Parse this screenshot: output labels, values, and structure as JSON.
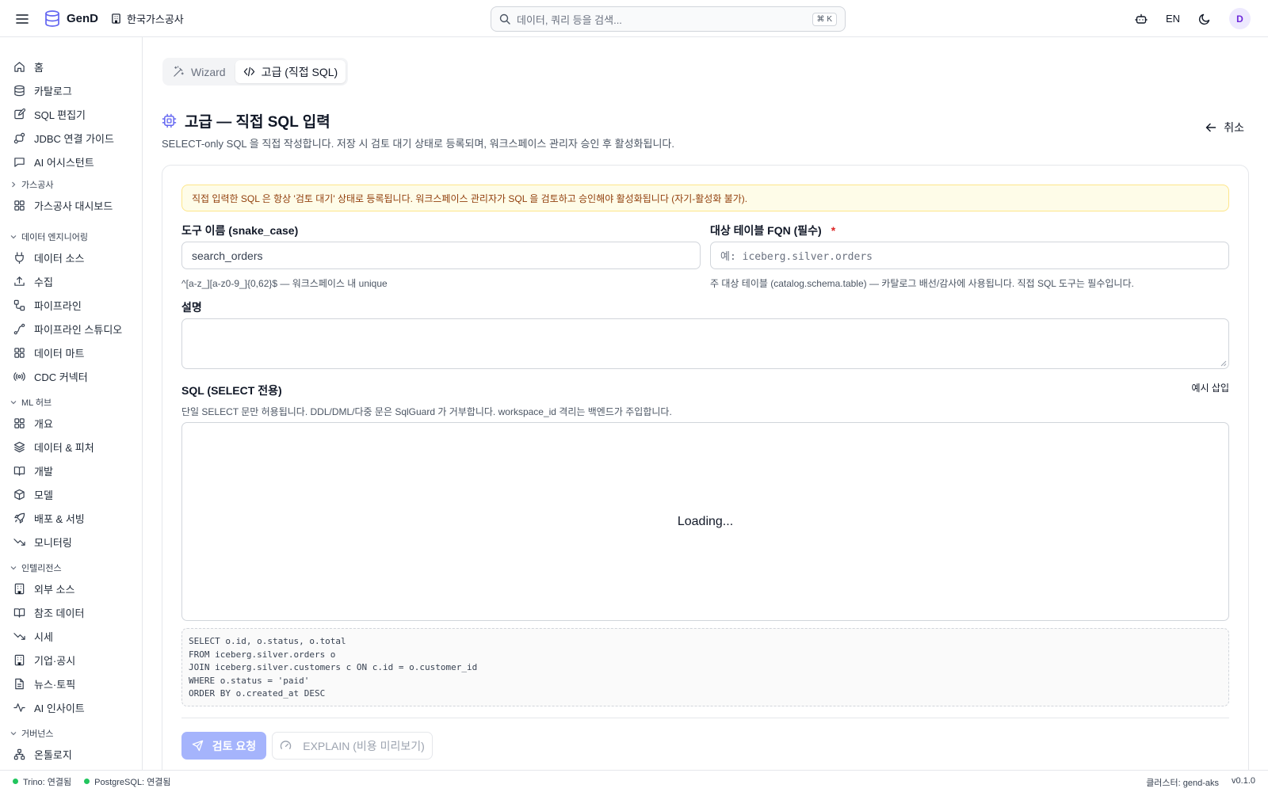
{
  "app": {
    "name": "GenD",
    "org": "한국가스공사"
  },
  "search": {
    "placeholder": "데이터, 쿼리 등을 검색...",
    "shortcut": "⌘ K"
  },
  "top": {
    "lang": "EN",
    "avatar": "D"
  },
  "sidebar": {
    "main": [
      {
        "label": "홈",
        "icon": "home-icon"
      },
      {
        "label": "카탈로그",
        "icon": "database-icon"
      },
      {
        "label": "SQL 편집기",
        "icon": "edit-icon"
      },
      {
        "label": "JDBC 연결 가이드",
        "icon": "plug-icon"
      },
      {
        "label": "AI 어시스턴트",
        "icon": "chat-icon"
      }
    ],
    "groups": [
      {
        "label": "가스공사",
        "collapsed": true,
        "items": [
          {
            "label": "가스공사 대시보드",
            "icon": "grid-icon"
          }
        ]
      },
      {
        "label": "데이터 엔지니어링",
        "collapsed": false,
        "items": [
          {
            "label": "데이터 소스",
            "icon": "plug-icon"
          },
          {
            "label": "수집",
            "icon": "upload-icon"
          },
          {
            "label": "파이프라인",
            "icon": "workflow-icon"
          },
          {
            "label": "파이프라인 스튜디오",
            "icon": "spline-icon"
          },
          {
            "label": "데이터 마트",
            "icon": "grid-icon"
          },
          {
            "label": "CDC 커넥터",
            "icon": "radio-icon"
          }
        ]
      },
      {
        "label": "ML 허브",
        "collapsed": false,
        "items": [
          {
            "label": "개요",
            "icon": "grid-icon"
          },
          {
            "label": "데이터 & 피처",
            "icon": "layers-icon"
          },
          {
            "label": "개발",
            "icon": "book-icon"
          },
          {
            "label": "모델",
            "icon": "box-icon"
          },
          {
            "label": "배포 & 서빙",
            "icon": "rocket-icon"
          },
          {
            "label": "모니터링",
            "icon": "trending-down-icon"
          }
        ]
      },
      {
        "label": "인텔리전스",
        "collapsed": false,
        "items": [
          {
            "label": "외부 소스",
            "icon": "building-icon"
          },
          {
            "label": "참조 데이터",
            "icon": "book-icon"
          },
          {
            "label": "시세",
            "icon": "trending-down-icon"
          },
          {
            "label": "기업·공시",
            "icon": "building-icon"
          },
          {
            "label": "뉴스·토픽",
            "icon": "file-icon"
          },
          {
            "label": "AI 인사이트",
            "icon": "activity-icon"
          }
        ]
      },
      {
        "label": "거버넌스",
        "collapsed": false,
        "items": [
          {
            "label": "온톨로지",
            "icon": "network-icon"
          }
        ]
      }
    ]
  },
  "tabs": [
    {
      "label": "Wizard"
    },
    {
      "label": "고급 (직접 SQL)"
    }
  ],
  "page": {
    "title": "고급 — 직접 SQL 입력",
    "subtitle": "SELECT-only SQL 을 직접 작성합니다. 저장 시 검토 대기 상태로 등록되며, 워크스페이스 관리자 승인 후 활성화됩니다.",
    "cancel": "취소"
  },
  "form": {
    "alert": "직접 입력한 SQL 은 항상 '검토 대기' 상태로 등록됩니다. 워크스페이스 관리자가 SQL 을 검토하고 승인해야 활성화됩니다 (자기-활성화 불가).",
    "tool_name": {
      "label": "도구 이름 (snake_case)",
      "value": "search_orders",
      "hint": "^[a-z_][a-z0-9_]{0,62}$ — 워크스페이스 내 unique"
    },
    "target_table": {
      "label": "대상 테이블 FQN (필수)",
      "required": "*",
      "placeholder": "예: iceberg.silver.orders",
      "hint": "주 대상 테이블 (catalog.schema.table) — 카탈로그 배선/감사에 사용됩니다. 직접 SQL 도구는 필수입니다."
    },
    "description": {
      "label": "설명",
      "value": ""
    },
    "sql": {
      "label": "SQL (SELECT 전용)",
      "insert_example": "예시 삽입",
      "hint": "단일 SELECT 문만 허용됩니다. DDL/DML/다중 문은 SqlGuard 가 거부합니다. workspace_id 격리는 백엔드가 주입합니다.",
      "editor_status": "Loading...",
      "example_lines": [
        "SELECT o.id, o.status, o.total",
        "FROM iceberg.silver.orders o",
        "JOIN iceberg.silver.customers c ON c.id = o.customer_id",
        "WHERE o.status = 'paid'",
        "ORDER BY o.created_at DESC"
      ]
    },
    "submit": "검토 요청",
    "explain": "EXPLAIN (비용 미리보기)"
  },
  "status": {
    "trino": "Trino: 연결됨",
    "postgres": "PostgreSQL: 연결됨",
    "cluster": "클러스터: gend-aks",
    "version": "v0.1.0"
  },
  "colors": {
    "accent": "#6366f1",
    "primary_disabled": "#a5b4fc",
    "alert_bg": "#fefce8",
    "alert_text": "#92400e",
    "status_ok": "#22c55e"
  }
}
